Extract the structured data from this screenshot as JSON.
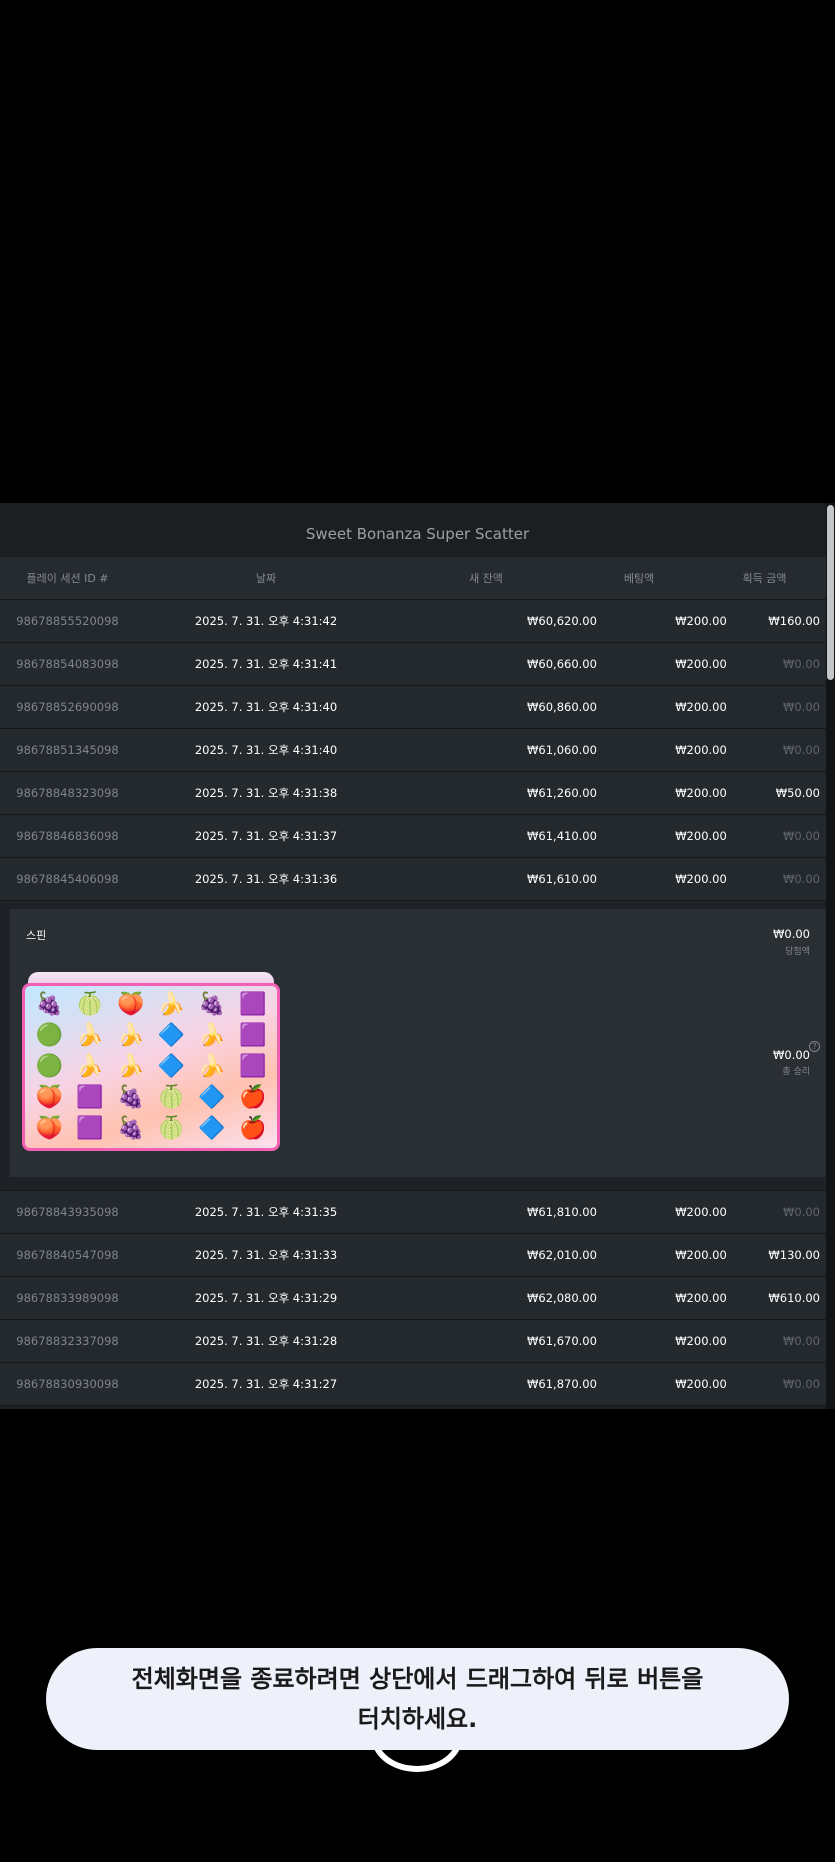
{
  "title": "Sweet Bonanza Super Scatter",
  "columns": [
    "플레이 세션 ID #",
    "날짜",
    "새 잔액",
    "베팅액",
    "획득 금액"
  ],
  "rows_before": [
    {
      "id": "98678855520098",
      "date": "2025. 7. 31. 오후 4:31:42",
      "balance": "₩60,620.00",
      "bet": "₩200.00",
      "win": "₩160.00"
    },
    {
      "id": "98678854083098",
      "date": "2025. 7. 31. 오후 4:31:41",
      "balance": "₩60,660.00",
      "bet": "₩200.00",
      "win": "₩0.00"
    },
    {
      "id": "98678852690098",
      "date": "2025. 7. 31. 오후 4:31:40",
      "balance": "₩60,860.00",
      "bet": "₩200.00",
      "win": "₩0.00"
    },
    {
      "id": "98678851345098",
      "date": "2025. 7. 31. 오후 4:31:40",
      "balance": "₩61,060.00",
      "bet": "₩200.00",
      "win": "₩0.00"
    },
    {
      "id": "98678848323098",
      "date": "2025. 7. 31. 오후 4:31:38",
      "balance": "₩61,260.00",
      "bet": "₩200.00",
      "win": "₩50.00"
    },
    {
      "id": "98678846836098",
      "date": "2025. 7. 31. 오후 4:31:37",
      "balance": "₩61,410.00",
      "bet": "₩200.00",
      "win": "₩0.00"
    },
    {
      "id": "98678845406098",
      "date": "2025. 7. 31. 오후 4:31:36",
      "balance": "₩61,610.00",
      "bet": "₩200.00",
      "win": "₩0.00"
    }
  ],
  "detail": {
    "label": "스핀",
    "bet_value": "₩0.00",
    "bet_caption": "당첨액",
    "win_value": "₩0.00",
    "win_caption": "총 승리",
    "help": "?",
    "board": [
      [
        "🍇",
        "🍈",
        "🍑",
        "🍌",
        "🍇",
        "🟪"
      ],
      [
        "🟢",
        "🍌",
        "🍌",
        "🔷",
        "🍌",
        "🟪"
      ],
      [
        "🟢",
        "🍌",
        "🍌",
        "🔷",
        "🍌",
        "🟪"
      ],
      [
        "🍑",
        "🟪",
        "🍇",
        "🍈",
        "🔷",
        "🍎"
      ],
      [
        "🍑",
        "🟪",
        "🍇",
        "🍈",
        "🔷",
        "🍎"
      ]
    ]
  },
  "rows_after": [
    {
      "id": "98678843935098",
      "date": "2025. 7. 31. 오후 4:31:35",
      "balance": "₩61,810.00",
      "bet": "₩200.00",
      "win": "₩0.00"
    },
    {
      "id": "98678840547098",
      "date": "2025. 7. 31. 오후 4:31:33",
      "balance": "₩62,010.00",
      "bet": "₩200.00",
      "win": "₩130.00"
    },
    {
      "id": "98678833989098",
      "date": "2025. 7. 31. 오후 4:31:29",
      "balance": "₩62,080.00",
      "bet": "₩200.00",
      "win": "₩610.00"
    },
    {
      "id": "98678832337098",
      "date": "2025. 7. 31. 오후 4:31:28",
      "balance": "₩61,670.00",
      "bet": "₩200.00",
      "win": "₩0.00"
    },
    {
      "id": "98678830930098",
      "date": "2025. 7. 31. 오후 4:31:27",
      "balance": "₩61,870.00",
      "bet": "₩200.00",
      "win": "₩0.00"
    }
  ],
  "toast": {
    "line1": "전체화면을 종료하려면 상단에서 드래그하여 뒤로 버튼을",
    "line2": "터치하세요."
  }
}
